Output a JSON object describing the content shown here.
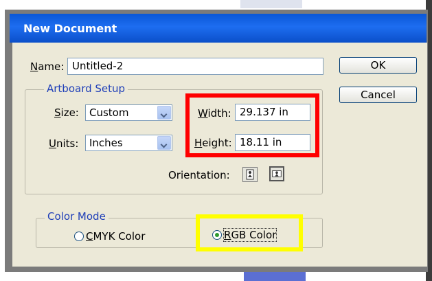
{
  "window": {
    "title": "New Document"
  },
  "name_row": {
    "label": "Name:",
    "value": "Untitled-2"
  },
  "buttons": {
    "ok": "OK",
    "cancel": "Cancel"
  },
  "artboard": {
    "legend": "Artboard Setup",
    "size_label": "Size:",
    "size_value": "Custom",
    "units_label": "Units:",
    "units_value": "Inches",
    "width_label": "Width:",
    "width_value": "29.137 in",
    "height_label": "Height:",
    "height_value": "18.11 in",
    "orientation_label": "Orientation:"
  },
  "color_mode": {
    "legend": "Color Mode",
    "cmyk": "CMYK Color",
    "rgb": "RGB Color",
    "selected": "RGB Color"
  },
  "colors": {
    "titlebar": "#0a57d6",
    "dialog_bg": "#ece9d8",
    "highlight_red": "#ff0000",
    "highlight_yellow": "#ffff00",
    "legend_text": "#1f3fb8"
  },
  "icons": {
    "dropdown": "chevron-down-icon",
    "orientation_portrait": "portrait-orientation-icon",
    "orientation_landscape": "landscape-orientation-icon"
  }
}
